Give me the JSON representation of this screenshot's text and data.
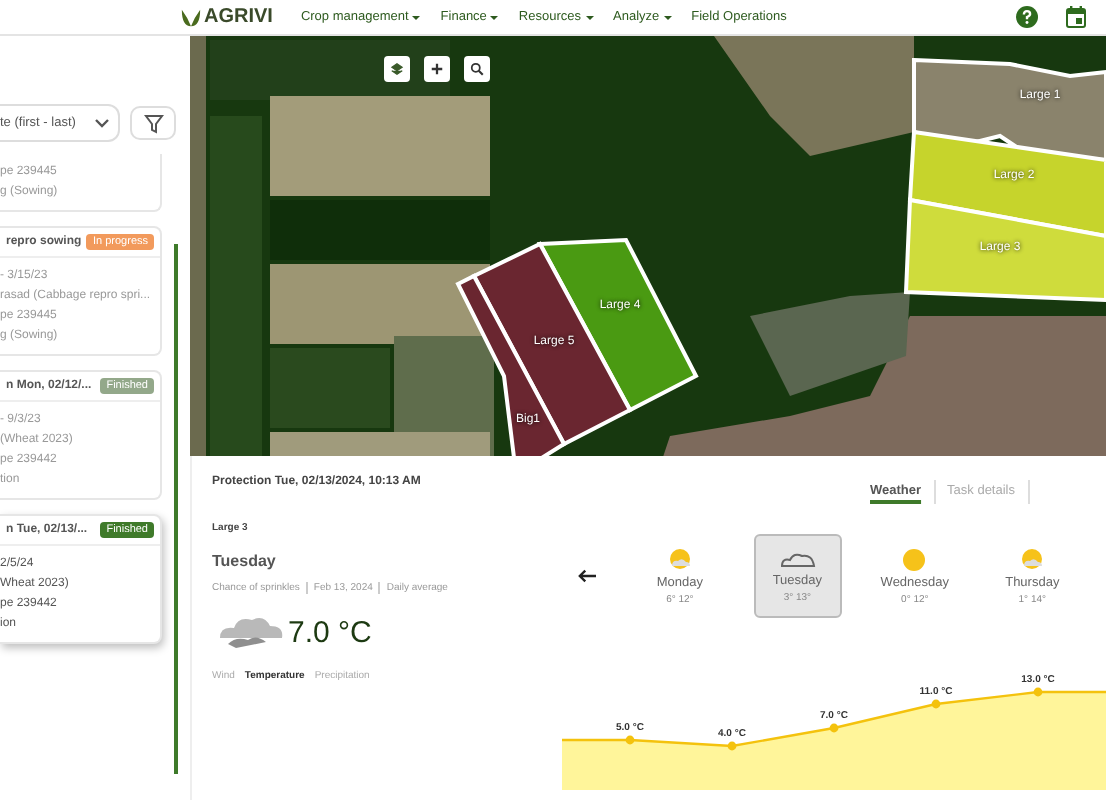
{
  "nav": {
    "logo": "AGRIVI",
    "menus": [
      {
        "label": "Crop management",
        "dropdown": true
      },
      {
        "label": "Finance",
        "dropdown": true
      },
      {
        "label": "Resources",
        "dropdown": true
      },
      {
        "label": "Analyze",
        "dropdown": true
      },
      {
        "label": "Field Operations",
        "dropdown": false
      }
    ]
  },
  "sidebar": {
    "sort": "te (first - last)",
    "cards": [
      {
        "selected": false,
        "lines": [
          "pe 239445",
          "g (Sowing)"
        ]
      },
      {
        "title": "repro sowing",
        "badge": "In progress",
        "color": "#f29a5c",
        "selected": false,
        "lines": [
          "- 3/15/23",
          "rasad (Cabbage repro spri...",
          "pe 239445",
          "g (Sowing)"
        ]
      },
      {
        "title": "n Mon, 02/12/...",
        "badge": "Finished",
        "color": "#93a88a",
        "selected": false,
        "lines": [
          "- 9/3/23",
          "(Wheat 2023)",
          "pe 239442",
          "tion"
        ]
      },
      {
        "title": "n Tue, 02/13/...",
        "badge": "Finished",
        "color": "#3f7a2a",
        "selected": true,
        "lines": [
          "2/5/24",
          "Wheat 2023)",
          "pe 239442",
          "ion"
        ]
      }
    ]
  },
  "map": {
    "fields": [
      {
        "label": "Large 1",
        "kind": "bare"
      },
      {
        "label": "Large 2",
        "kind": "crop"
      },
      {
        "label": "Large 3",
        "kind": "crop-light"
      },
      {
        "label": "Large 4",
        "kind": "green"
      },
      {
        "label": "Large 5",
        "kind": "maroon"
      },
      {
        "label": "Big1",
        "kind": "maroon"
      }
    ]
  },
  "detail": {
    "title": "Protection Tue, 02/13/2024, 10:13 AM",
    "field": "Large 3",
    "day": "Tuesday",
    "meta": [
      "Chance of sprinkles",
      "Feb 13, 2024",
      "Daily average"
    ],
    "temperature": "7.0 °C",
    "modes": [
      {
        "label": "Wind",
        "selected": false
      },
      {
        "label": "Temperature",
        "selected": true
      },
      {
        "label": "Precipitation",
        "selected": false
      }
    ],
    "tabs": [
      {
        "label": "Weather",
        "selected": true
      },
      {
        "label": "Task details",
        "selected": false
      }
    ],
    "days": [
      {
        "name": "Monday",
        "range": "6° 12°",
        "kind": "partly",
        "selected": false
      },
      {
        "name": "Tuesday",
        "range": "3° 13°",
        "kind": "cloudy",
        "selected": true
      },
      {
        "name": "Wednesday",
        "range": "0° 12°",
        "kind": "sunny",
        "selected": false
      },
      {
        "name": "Thursday",
        "range": "1° 14°",
        "kind": "partly",
        "selected": false
      }
    ],
    "temperature_labels": [
      "5.0 °C",
      "4.0 °C",
      "7.0 °C",
      "11.0 °C",
      "13.0 °C"
    ]
  }
}
